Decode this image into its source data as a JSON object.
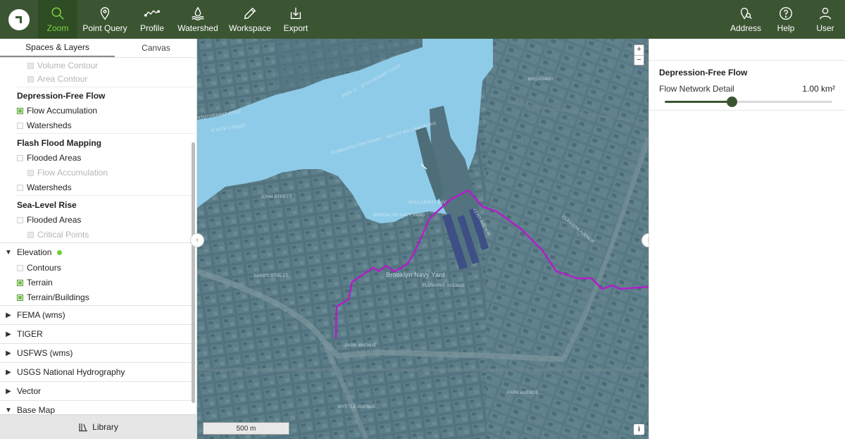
{
  "toolbar": {
    "left_tools": [
      {
        "label": "Zoom",
        "icon": "search-icon",
        "active": true
      },
      {
        "label": "Point Query",
        "icon": "map-pin-icon"
      },
      {
        "label": "Profile",
        "icon": "profile-line-icon"
      },
      {
        "label": "Watershed",
        "icon": "water-drop-icon"
      },
      {
        "label": "Workspace",
        "icon": "pencil-icon"
      },
      {
        "label": "Export",
        "icon": "download-icon"
      }
    ],
    "right_tools": [
      {
        "label": "Address",
        "icon": "address-search-icon"
      },
      {
        "label": "Help",
        "icon": "help-icon"
      },
      {
        "label": "User",
        "icon": "user-icon"
      }
    ]
  },
  "left_panel": {
    "tabs": [
      "Spaces & Layers",
      "Canvas"
    ],
    "rows": {
      "volume_contour": "Volume Contour",
      "area_contour": "Area Contour",
      "dff_title": "Depression-Free Flow",
      "dff_flow_acc": "Flow Accumulation",
      "dff_watersheds": "Watersheds",
      "ffm_title": "Flash Flood Mapping",
      "ffm_flooded": "Flooded Areas",
      "ffm_flow_acc": "Flow Accumulation",
      "ffm_watersheds": "Watersheds",
      "slr_title": "Sea-Level Rise",
      "slr_flooded": "Flooded Areas",
      "slr_critical": "Critical Points",
      "elevation": "Elevation",
      "contours": "Contours",
      "terrain": "Terrain",
      "terrain_buildings": "Terrain/Buildings",
      "fema": "FEMA (wms)",
      "tiger": "TIGER",
      "usfws": "USFWS (wms)",
      "usgs": "USGS National Hydrography",
      "vector": "Vector",
      "basemap": "Base Map"
    },
    "library": "Library"
  },
  "map": {
    "zoom_in": "+",
    "zoom_out": "−",
    "scale": "500 m",
    "info": "i",
    "labels": {
      "yard": "BROOKLYN NAVY YARD",
      "navy_yard": "Brooklyn Navy Yard",
      "cove": "WALLABOUT BAY",
      "park_avenue": "PARK AVENUE",
      "park_avenue2": "PARK AVENUE",
      "john_street": "JOHN STREET",
      "sands_street": "SANDS STREET",
      "flushing": "FLUSHING AVENUE",
      "ferry": "DUMBO/FULTON FERRY - SOUTH WILLIAMSBURG",
      "ferry2": "PIER 11 - STUYVESANT COVE",
      "street34": "E 34TH STREET",
      "stuyvesant": "STUYVESANT COVE",
      "myrtle": "MYRTLE AVENUE",
      "kent": "KENT AVENUE",
      "broadway": "BROADWAY",
      "classon": "CLASSON AVENUE"
    }
  },
  "right_panel": {
    "title": "Depression-Free Flow",
    "setting_label": "Flow Network Detail",
    "setting_value": "1.00 km²",
    "slider_fraction": 0.4
  },
  "colors": {
    "toolbar_bg": "#3b5532",
    "active_green": "#7cd33e",
    "water": "#8ecbe8",
    "land": "#51727f",
    "flow_line": "#b01fc7"
  }
}
